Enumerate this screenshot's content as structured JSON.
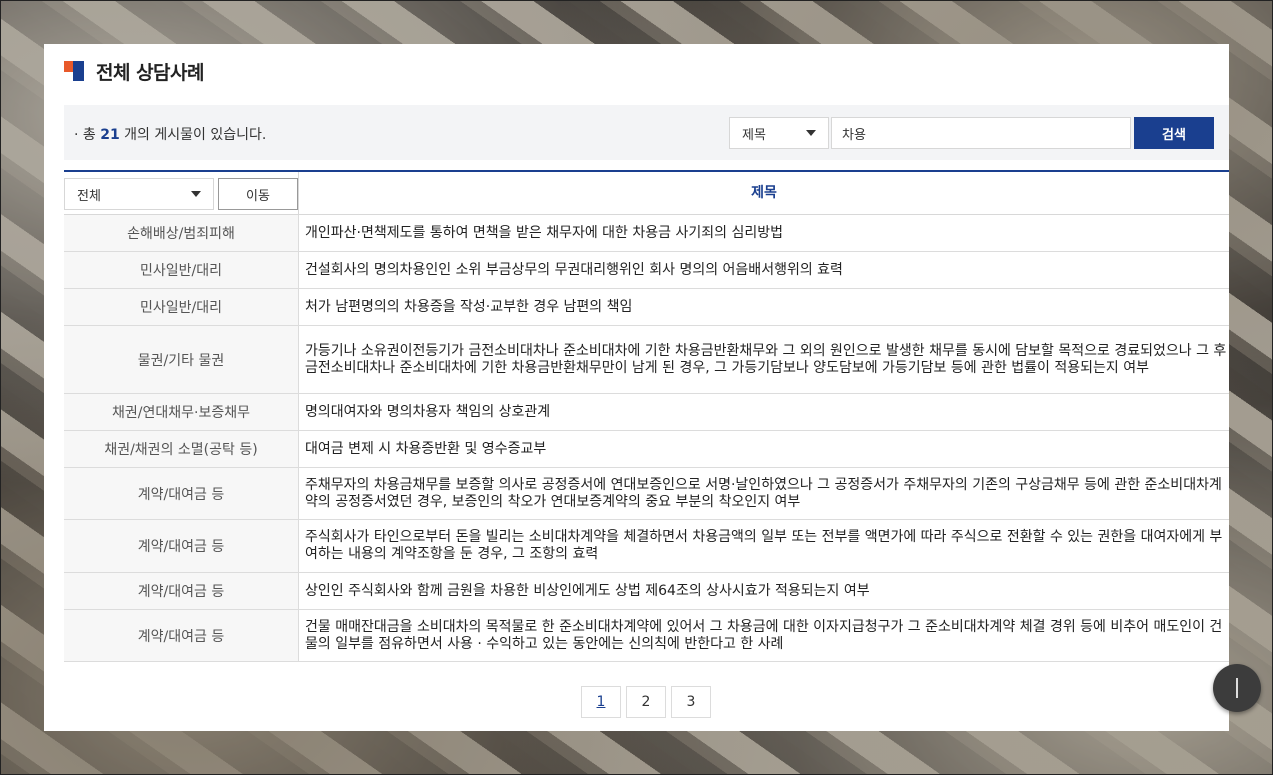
{
  "header": {
    "title": "전체 상담사례"
  },
  "search": {
    "count_prefix": "· 총 ",
    "count": "21",
    "count_suffix": " 개의 게시물이 있습니다.",
    "field_selected": "제목",
    "query": "차용",
    "search_label": "검색"
  },
  "table": {
    "category_filter": "전체",
    "move_label": "이동",
    "column_title": "제목",
    "rows": [
      {
        "category": "손해배상/범죄피해",
        "title": "개인파산·면책제도를 통하여 면책을 받은 채무자에 대한 차용금 사기죄의 심리방법"
      },
      {
        "category": "민사일반/대리",
        "title": "건설회사의 명의차용인인 소위 부금상무의 무권대리행위인 회사 명의의 어음배서행위의 효력"
      },
      {
        "category": "민사일반/대리",
        "title": "처가 남편명의의 차용증을 작성·교부한 경우 남편의 책임"
      },
      {
        "category": "물권/기타 물권",
        "title": "가등기나 소유권이전등기가 금전소비대차나 준소비대차에 기한 차용금반환채무와 그 외의 원인으로 발생한 채무를 동시에 담보할 목적으로 경료되었으나 그 후 금전소비대차나 준소비대차에 기한 차용금반환채무만이 남게 된 경우, 그 가등기담보나 양도담보에 가등기담보 등에 관한 법률이 적용되는지 여부"
      },
      {
        "category": "채권/연대채무·보증채무",
        "title": "명의대여자와 명의차용자 책임의 상호관계"
      },
      {
        "category": "채권/채권의 소멸(공탁 등)",
        "title": "대여금 변제 시 차용증반환 및 영수증교부"
      },
      {
        "category": "계약/대여금 등",
        "title": "주채무자의 차용금채무를 보증할 의사로 공정증서에 연대보증인으로 서명·날인하였으나 그 공정증서가 주채무자의 기존의 구상금채무 등에 관한 준소비대차계약의 공정증서였던 경우, 보증인의 착오가 연대보증계약의 중요 부분의 착오인지 여부"
      },
      {
        "category": "계약/대여금 등",
        "title": "주식회사가 타인으로부터 돈을 빌리는 소비대차계약을 체결하면서 차용금액의 일부 또는 전부를 액면가에 따라 주식으로 전환할 수 있는 권한을 대여자에게 부여하는 내용의 계약조항을 둔 경우, 그 조항의 효력"
      },
      {
        "category": "계약/대여금 등",
        "title": "상인인 주식회사와 함께 금원을 차용한 비상인에게도 상법 제64조의 상사시효가 적용되는지 여부"
      },
      {
        "category": "계약/대여금 등",
        "title": "건물 매매잔대금을 소비대차의 목적물로 한 준소비대차계약에 있어서 그 차용금에 대한 이자지급청구가 그 준소비대차계약 체결 경위 등에 비추어 매도인이 건물의 일부를 점유하면서 사용 · 수익하고 있는 동안에는 신의칙에 반한다고 한 사례"
      }
    ]
  },
  "pagination": {
    "pages": [
      "1",
      "2",
      "3"
    ],
    "current": "1"
  },
  "colors": {
    "brand": "#1a3f8f",
    "accent": "#e8592a"
  }
}
